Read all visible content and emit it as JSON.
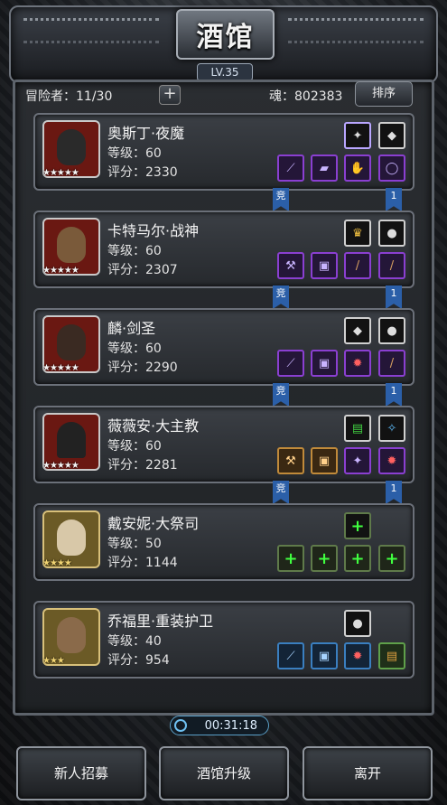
{
  "header": {
    "title": "酒馆",
    "level": "LV.35"
  },
  "topbar": {
    "adventurers_label": "冒险者：11/30",
    "add_label": "+",
    "soul_label": "魂：802383",
    "sort_label": "排序"
  },
  "cards": [
    {
      "name": "奥斯丁·夜魔",
      "level": "等级：60",
      "score": "评分：2330",
      "banner_left": "竞",
      "banner_right": "1"
    },
    {
      "name": "卡特马尔·战神",
      "level": "等级：60",
      "score": "评分：2307",
      "banner_left": "竞",
      "banner_right": "1"
    },
    {
      "name": "麟·剑圣",
      "level": "等级：60",
      "score": "评分：2290",
      "banner_left": "竞",
      "banner_right": "1"
    },
    {
      "name": "薇薇安·大主教",
      "level": "等级：60",
      "score": "评分：2281",
      "banner_left": "竞",
      "banner_right": "1"
    },
    {
      "name": "戴安妮·大祭司",
      "level": "等级：50",
      "score": "评分：1144"
    },
    {
      "name": "乔福里·重装护卫",
      "level": "等级：40",
      "score": "评分：954"
    }
  ],
  "footer": {
    "timer": "00:31:18",
    "buttons": [
      "新人招募",
      "酒馆升级",
      "离开"
    ]
  },
  "colors": {
    "equip_purple": "#8a3fd1",
    "equip_orange": "#c08a3a",
    "banner_blue": "#2b5fa8",
    "plus_green": "#40ff40"
  }
}
